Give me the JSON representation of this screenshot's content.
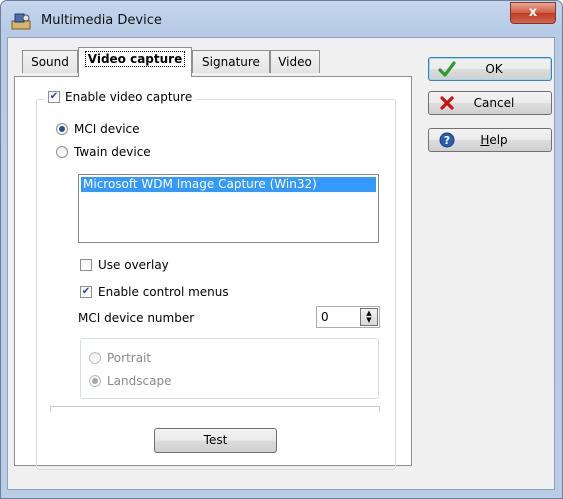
{
  "window": {
    "title": "Multimedia Device",
    "close_glyph": "x"
  },
  "tabs": [
    {
      "label": "Sound",
      "active": false
    },
    {
      "label": "Video capture",
      "active": true
    },
    {
      "label": "Signature",
      "active": false
    },
    {
      "label": "Video",
      "active": false
    }
  ],
  "video_capture": {
    "enable_label": "Enable video capture",
    "enable_checked": true,
    "mci_label": "MCI device",
    "mci_selected": true,
    "twain_label": "Twain device",
    "twain_selected": false,
    "devices": [
      "Microsoft WDM Image Capture (Win32)"
    ],
    "use_overlay_label": "Use overlay",
    "use_overlay_checked": false,
    "control_menus_label": "Enable control menus",
    "control_menus_checked": true,
    "mci_number_label": "MCI device number",
    "mci_number_value": "0",
    "portrait_label": "Portrait",
    "landscape_label": "Landscape",
    "orientation": "Landscape",
    "test_label": "Test"
  },
  "buttons": {
    "ok_label": "OK",
    "cancel_label": "Cancel",
    "help_label_prefix": "",
    "help_label_underlined": "H",
    "help_label_rest": "elp"
  },
  "icons": {
    "app": "multimedia-device-icon",
    "ok": "checkmark-icon",
    "cancel": "red-x-icon",
    "help": "question-mark-icon"
  },
  "colors": {
    "selection": "#3399ff",
    "ok_check": "#2f9a2f",
    "cancel_x": "#cc1010",
    "help_circle": "#2a5db0"
  }
}
